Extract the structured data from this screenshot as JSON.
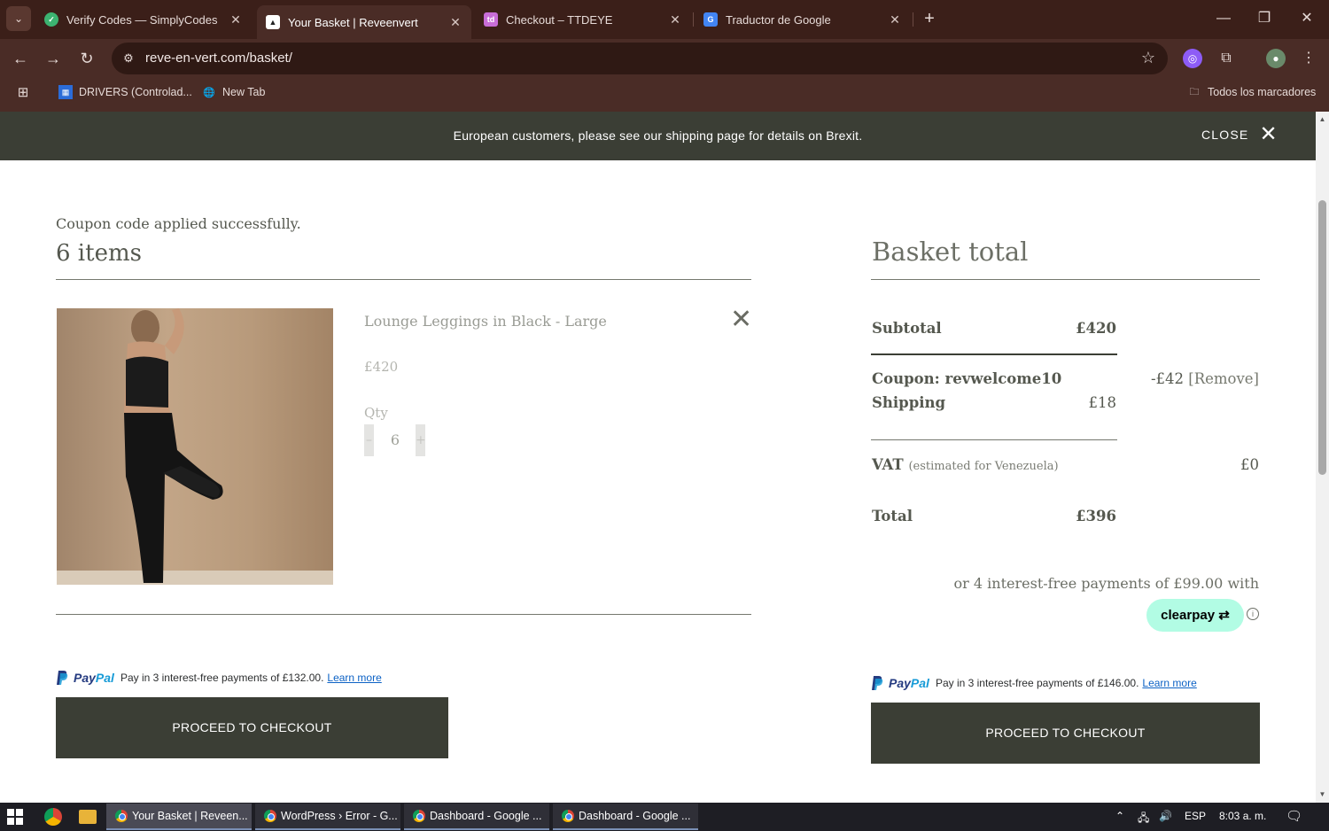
{
  "browser": {
    "tabs": [
      {
        "title": "Verify Codes — SimplyCodes",
        "icon": "simplycodes-icon",
        "color": "#3cb371",
        "active": false
      },
      {
        "title": "Your Basket | Reveenvert",
        "icon": "reveenvert-icon",
        "color": "#ffffff",
        "active": true
      },
      {
        "title": "Checkout – TTDEYE",
        "icon": "ttdeye-icon",
        "color": "#c86dd7",
        "active": false
      },
      {
        "title": "Traductor de Google",
        "icon": "google-translate-icon",
        "color": "#4285f4",
        "active": false
      }
    ],
    "url": "reve-en-vert.com/basket/",
    "bookmarks": [
      {
        "label": "DRIVERS (Controlad...",
        "icon": "drivers-icon"
      },
      {
        "label": "New Tab",
        "icon": "globe-icon"
      }
    ],
    "all_bookmarks": "Todos los marcadores"
  },
  "banner": {
    "text": "European customers, please see our shipping page for details on Brexit.",
    "close_label": "CLOSE"
  },
  "basket": {
    "coupon_message": "Coupon code applied successfully.",
    "items_heading": "6 items",
    "item": {
      "name": "Lounge Leggings in Black - Large",
      "price": "£420",
      "qty_label": "Qty",
      "qty": "6",
      "minus": "–",
      "plus": "+"
    },
    "paypal": {
      "word_pay": "Pay",
      "word_pal": "Pal",
      "text": "Pay in 3 interest-free payments of £132.00.",
      "learn_more": "Learn more"
    },
    "checkout_label": "PROCEED TO CHECKOUT"
  },
  "totals": {
    "heading": "Basket total",
    "subtotal_label": "Subtotal",
    "subtotal_value": "£420",
    "coupon_label": "Coupon: revwelcome10",
    "coupon_value": "-£42",
    "coupon_remove": "[Remove]",
    "shipping_label": "Shipping",
    "shipping_value": "£18",
    "vat_label": "VAT",
    "vat_note": "(estimated for Venezuela)",
    "vat_value": "£0",
    "total_label": "Total",
    "total_value": "£396",
    "clearpay_text": "or 4 interest-free payments of £99.00 with",
    "clearpay_brand": "clearpay",
    "paypal": {
      "word_pay": "Pay",
      "word_pal": "Pal",
      "text": "Pay in 3 interest-free payments of £146.00.",
      "learn_more": "Learn more"
    },
    "checkout_label": "PROCEED TO CHECKOUT"
  },
  "taskbar": {
    "tasks": [
      {
        "label": "Your Basket | Reveen...",
        "active": true
      },
      {
        "label": "WordPress › Error - G...",
        "active": false
      },
      {
        "label": "Dashboard - Google ...",
        "active": false
      },
      {
        "label": "Dashboard - Google ...",
        "active": false
      }
    ],
    "language": "ESP",
    "time": "8:03 a. m."
  },
  "colors": {
    "browser_frame": "#4a2c26",
    "banner_bg": "#3b3e35",
    "button_bg": "#3b3e35",
    "clearpay_mint": "#b2fce4",
    "paypal_blue": "#253b80"
  }
}
